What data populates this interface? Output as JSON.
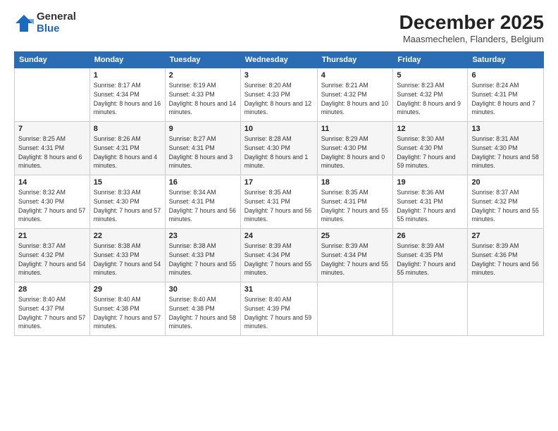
{
  "logo": {
    "general": "General",
    "blue": "Blue"
  },
  "title": "December 2025",
  "subtitle": "Maasmechelen, Flanders, Belgium",
  "days_header": [
    "Sunday",
    "Monday",
    "Tuesday",
    "Wednesday",
    "Thursday",
    "Friday",
    "Saturday"
  ],
  "weeks": [
    [
      {
        "num": "",
        "sunrise": "",
        "sunset": "",
        "daylight": ""
      },
      {
        "num": "1",
        "sunrise": "Sunrise: 8:17 AM",
        "sunset": "Sunset: 4:34 PM",
        "daylight": "Daylight: 8 hours and 16 minutes."
      },
      {
        "num": "2",
        "sunrise": "Sunrise: 8:19 AM",
        "sunset": "Sunset: 4:33 PM",
        "daylight": "Daylight: 8 hours and 14 minutes."
      },
      {
        "num": "3",
        "sunrise": "Sunrise: 8:20 AM",
        "sunset": "Sunset: 4:33 PM",
        "daylight": "Daylight: 8 hours and 12 minutes."
      },
      {
        "num": "4",
        "sunrise": "Sunrise: 8:21 AM",
        "sunset": "Sunset: 4:32 PM",
        "daylight": "Daylight: 8 hours and 10 minutes."
      },
      {
        "num": "5",
        "sunrise": "Sunrise: 8:23 AM",
        "sunset": "Sunset: 4:32 PM",
        "daylight": "Daylight: 8 hours and 9 minutes."
      },
      {
        "num": "6",
        "sunrise": "Sunrise: 8:24 AM",
        "sunset": "Sunset: 4:31 PM",
        "daylight": "Daylight: 8 hours and 7 minutes."
      }
    ],
    [
      {
        "num": "7",
        "sunrise": "Sunrise: 8:25 AM",
        "sunset": "Sunset: 4:31 PM",
        "daylight": "Daylight: 8 hours and 6 minutes."
      },
      {
        "num": "8",
        "sunrise": "Sunrise: 8:26 AM",
        "sunset": "Sunset: 4:31 PM",
        "daylight": "Daylight: 8 hours and 4 minutes."
      },
      {
        "num": "9",
        "sunrise": "Sunrise: 8:27 AM",
        "sunset": "Sunset: 4:31 PM",
        "daylight": "Daylight: 8 hours and 3 minutes."
      },
      {
        "num": "10",
        "sunrise": "Sunrise: 8:28 AM",
        "sunset": "Sunset: 4:30 PM",
        "daylight": "Daylight: 8 hours and 1 minute."
      },
      {
        "num": "11",
        "sunrise": "Sunrise: 8:29 AM",
        "sunset": "Sunset: 4:30 PM",
        "daylight": "Daylight: 8 hours and 0 minutes."
      },
      {
        "num": "12",
        "sunrise": "Sunrise: 8:30 AM",
        "sunset": "Sunset: 4:30 PM",
        "daylight": "Daylight: 7 hours and 59 minutes."
      },
      {
        "num": "13",
        "sunrise": "Sunrise: 8:31 AM",
        "sunset": "Sunset: 4:30 PM",
        "daylight": "Daylight: 7 hours and 58 minutes."
      }
    ],
    [
      {
        "num": "14",
        "sunrise": "Sunrise: 8:32 AM",
        "sunset": "Sunset: 4:30 PM",
        "daylight": "Daylight: 7 hours and 57 minutes."
      },
      {
        "num": "15",
        "sunrise": "Sunrise: 8:33 AM",
        "sunset": "Sunset: 4:30 PM",
        "daylight": "Daylight: 7 hours and 57 minutes."
      },
      {
        "num": "16",
        "sunrise": "Sunrise: 8:34 AM",
        "sunset": "Sunset: 4:31 PM",
        "daylight": "Daylight: 7 hours and 56 minutes."
      },
      {
        "num": "17",
        "sunrise": "Sunrise: 8:35 AM",
        "sunset": "Sunset: 4:31 PM",
        "daylight": "Daylight: 7 hours and 56 minutes."
      },
      {
        "num": "18",
        "sunrise": "Sunrise: 8:35 AM",
        "sunset": "Sunset: 4:31 PM",
        "daylight": "Daylight: 7 hours and 55 minutes."
      },
      {
        "num": "19",
        "sunrise": "Sunrise: 8:36 AM",
        "sunset": "Sunset: 4:31 PM",
        "daylight": "Daylight: 7 hours and 55 minutes."
      },
      {
        "num": "20",
        "sunrise": "Sunrise: 8:37 AM",
        "sunset": "Sunset: 4:32 PM",
        "daylight": "Daylight: 7 hours and 55 minutes."
      }
    ],
    [
      {
        "num": "21",
        "sunrise": "Sunrise: 8:37 AM",
        "sunset": "Sunset: 4:32 PM",
        "daylight": "Daylight: 7 hours and 54 minutes."
      },
      {
        "num": "22",
        "sunrise": "Sunrise: 8:38 AM",
        "sunset": "Sunset: 4:33 PM",
        "daylight": "Daylight: 7 hours and 54 minutes."
      },
      {
        "num": "23",
        "sunrise": "Sunrise: 8:38 AM",
        "sunset": "Sunset: 4:33 PM",
        "daylight": "Daylight: 7 hours and 55 minutes."
      },
      {
        "num": "24",
        "sunrise": "Sunrise: 8:39 AM",
        "sunset": "Sunset: 4:34 PM",
        "daylight": "Daylight: 7 hours and 55 minutes."
      },
      {
        "num": "25",
        "sunrise": "Sunrise: 8:39 AM",
        "sunset": "Sunset: 4:34 PM",
        "daylight": "Daylight: 7 hours and 55 minutes."
      },
      {
        "num": "26",
        "sunrise": "Sunrise: 8:39 AM",
        "sunset": "Sunset: 4:35 PM",
        "daylight": "Daylight: 7 hours and 55 minutes."
      },
      {
        "num": "27",
        "sunrise": "Sunrise: 8:39 AM",
        "sunset": "Sunset: 4:36 PM",
        "daylight": "Daylight: 7 hours and 56 minutes."
      }
    ],
    [
      {
        "num": "28",
        "sunrise": "Sunrise: 8:40 AM",
        "sunset": "Sunset: 4:37 PM",
        "daylight": "Daylight: 7 hours and 57 minutes."
      },
      {
        "num": "29",
        "sunrise": "Sunrise: 8:40 AM",
        "sunset": "Sunset: 4:38 PM",
        "daylight": "Daylight: 7 hours and 57 minutes."
      },
      {
        "num": "30",
        "sunrise": "Sunrise: 8:40 AM",
        "sunset": "Sunset: 4:38 PM",
        "daylight": "Daylight: 7 hours and 58 minutes."
      },
      {
        "num": "31",
        "sunrise": "Sunrise: 8:40 AM",
        "sunset": "Sunset: 4:39 PM",
        "daylight": "Daylight: 7 hours and 59 minutes."
      },
      {
        "num": "",
        "sunrise": "",
        "sunset": "",
        "daylight": ""
      },
      {
        "num": "",
        "sunrise": "",
        "sunset": "",
        "daylight": ""
      },
      {
        "num": "",
        "sunrise": "",
        "sunset": "",
        "daylight": ""
      }
    ]
  ]
}
